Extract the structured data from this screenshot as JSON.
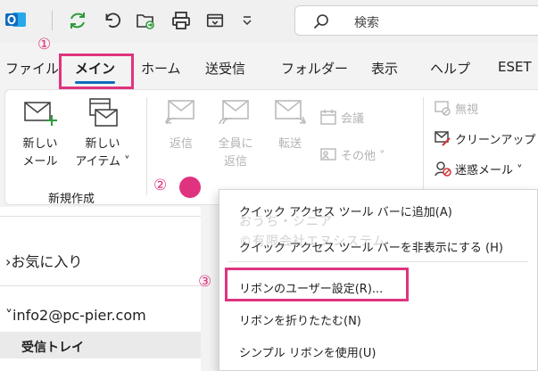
{
  "colors": {
    "accent": "#0f6cbd",
    "highlight": "#e0337f",
    "outlook_blue": "#0f6cbd",
    "green": "#2e9a3c"
  },
  "titlebar": {
    "icons": [
      "outlook-logo-icon",
      "sync-icon",
      "undo-icon",
      "move-folder-icon",
      "print-icon",
      "window-icon",
      "dropdown-icon"
    ],
    "search_placeholder": "検索"
  },
  "markers": {
    "one": "①",
    "two": "②",
    "three": "③"
  },
  "menu": {
    "items": [
      "ファイル",
      "メイン",
      "ホーム",
      "送受信",
      "フォルダー",
      "表示",
      "ヘルプ",
      "ESET"
    ],
    "active": "メイン"
  },
  "ribbon": {
    "new_mail": [
      "新しい",
      "メール"
    ],
    "new_item": [
      "新しい",
      "アイテム ˅"
    ],
    "group_label": "新規作成",
    "reply": "返信",
    "reply_all": [
      "全員に",
      "返信"
    ],
    "forward": "転送",
    "meeting": "会議",
    "other": "その他 ˅",
    "ignore": "無視",
    "cleanup": "クリーンアップ ˅",
    "junk": "迷惑メール ˅"
  },
  "left_pane": {
    "favorites": "お気に入り",
    "account": "info2@pc-pier.com",
    "inbox": "受信トレイ"
  },
  "context_menu": {
    "items": [
      "クイック アクセス ツール バーに追加(A)",
      "クイック アクセス ツール バーを非表示にする (H)",
      "リボンのユーザー設定(R)...",
      "リボンを折りたたむ(N)",
      "シンプル リボンを使用(U)"
    ]
  },
  "watermark": [
    "おうち・シニア",
    "©有限会社エヌシステム"
  ]
}
